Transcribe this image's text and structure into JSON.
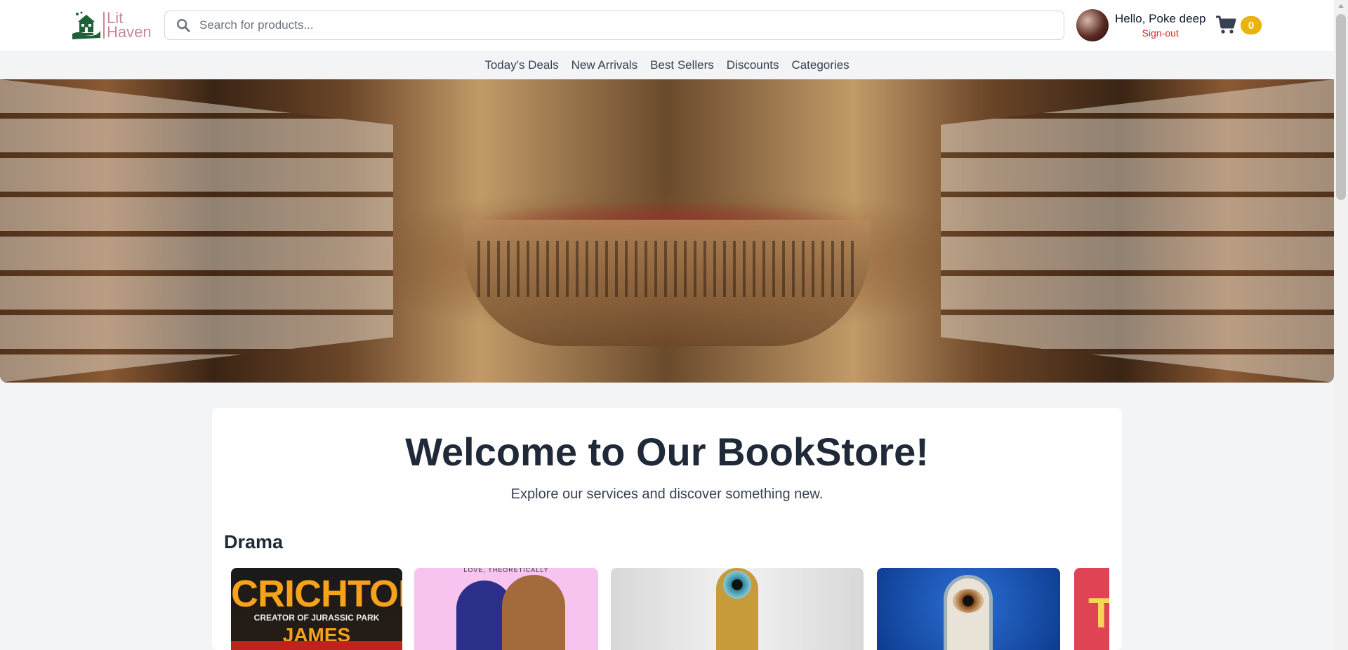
{
  "header": {
    "logo": {
      "line1": "Lit",
      "line2": "Haven",
      "icon": "bookstore-house-hand-icon"
    },
    "search": {
      "placeholder": "Search for products...",
      "value": "",
      "icon": "search-icon"
    },
    "user": {
      "greeting": "Hello, Poke deep",
      "signout_label": "Sign-out",
      "avatar": "user-avatar"
    },
    "cart": {
      "icon": "shopping-cart-icon",
      "count": "0"
    }
  },
  "nav": {
    "items": [
      {
        "label": "Today's Deals"
      },
      {
        "label": "New Arrivals"
      },
      {
        "label": "Best Sellers"
      },
      {
        "label": "Discounts"
      },
      {
        "label": "Categories"
      }
    ]
  },
  "hero": {
    "image": "library-interior-banner"
  },
  "main": {
    "title": "Welcome to Our BookStore!",
    "subtitle": "Explore our services and discover something new.",
    "section": {
      "title": "Drama",
      "books": [
        {
          "cover_title": "CRICHTON",
          "cover_line": "CREATOR OF JURASSIC PARK",
          "cover_author": "JAMES PATTERSON"
        },
        {
          "cover_line": "LOVE, THEORETICALLY"
        },
        {
          "cover": "keyhole-eye-cover"
        },
        {
          "cover": "blue-keyhole-eye-cover"
        },
        {
          "cover_title": "T"
        }
      ]
    }
  },
  "colors": {
    "accent": "#c58a97",
    "signout": "#dc2626",
    "badge": "#eab308",
    "logo_green": "#1f5f3a"
  }
}
